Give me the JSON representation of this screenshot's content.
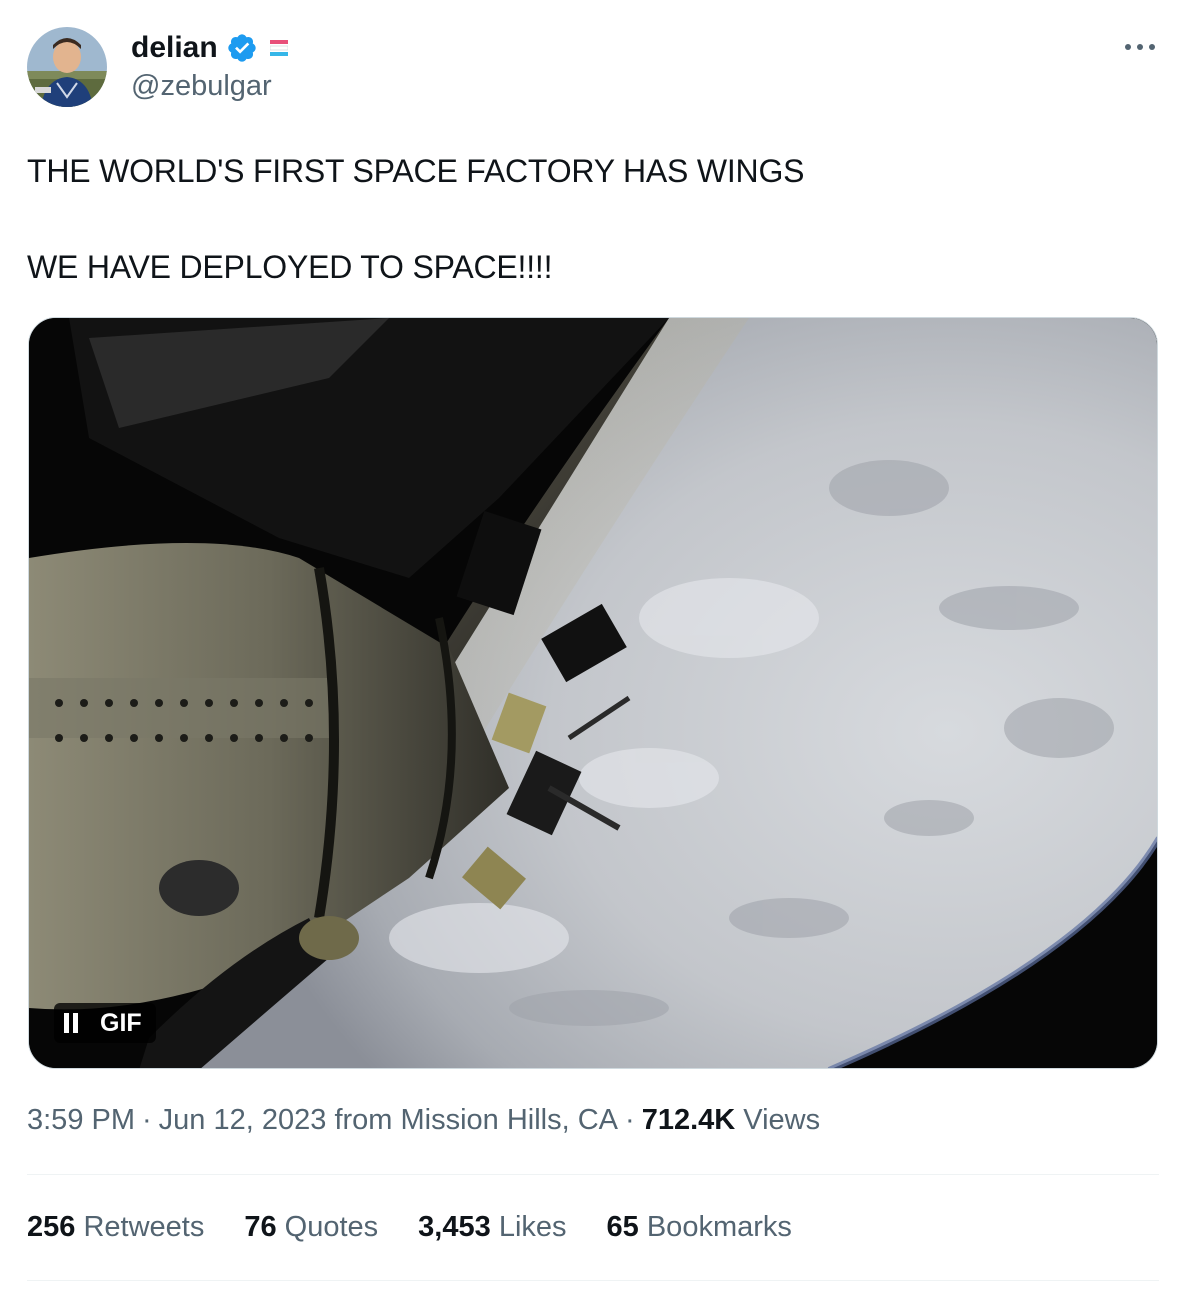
{
  "author": {
    "display_name": "delian",
    "handle": "@zebulgar",
    "avatar_icon": "avatar-photo",
    "verified_icon": "verified-badge-icon",
    "verified_color": "#1d9bf0",
    "flag_icon": "striped-flag-icon"
  },
  "tweet": {
    "lines": [
      "THE WORLD'S FIRST SPACE FACTORY HAS WINGS",
      "WE HAVE DEPLOYED TO SPACE!!!!"
    ]
  },
  "media": {
    "type": "gif",
    "badge_label": "GIF",
    "badge_icon": "pause-icon",
    "description_icon": "satellite-over-earth-image"
  },
  "meta": {
    "time": "3:59 PM",
    "separator": "·",
    "date": "Jun 12, 2023",
    "location": "from Mission Hills, CA",
    "views_count": "712.4K",
    "views_label": "Views"
  },
  "stats": [
    {
      "count": "256",
      "label": "Retweets"
    },
    {
      "count": "76",
      "label": "Quotes"
    },
    {
      "count": "3,453",
      "label": "Likes"
    },
    {
      "count": "65",
      "label": "Bookmarks"
    }
  ],
  "colors": {
    "text_primary": "#0f1419",
    "text_secondary": "#536471",
    "divider": "#eff3f4"
  }
}
